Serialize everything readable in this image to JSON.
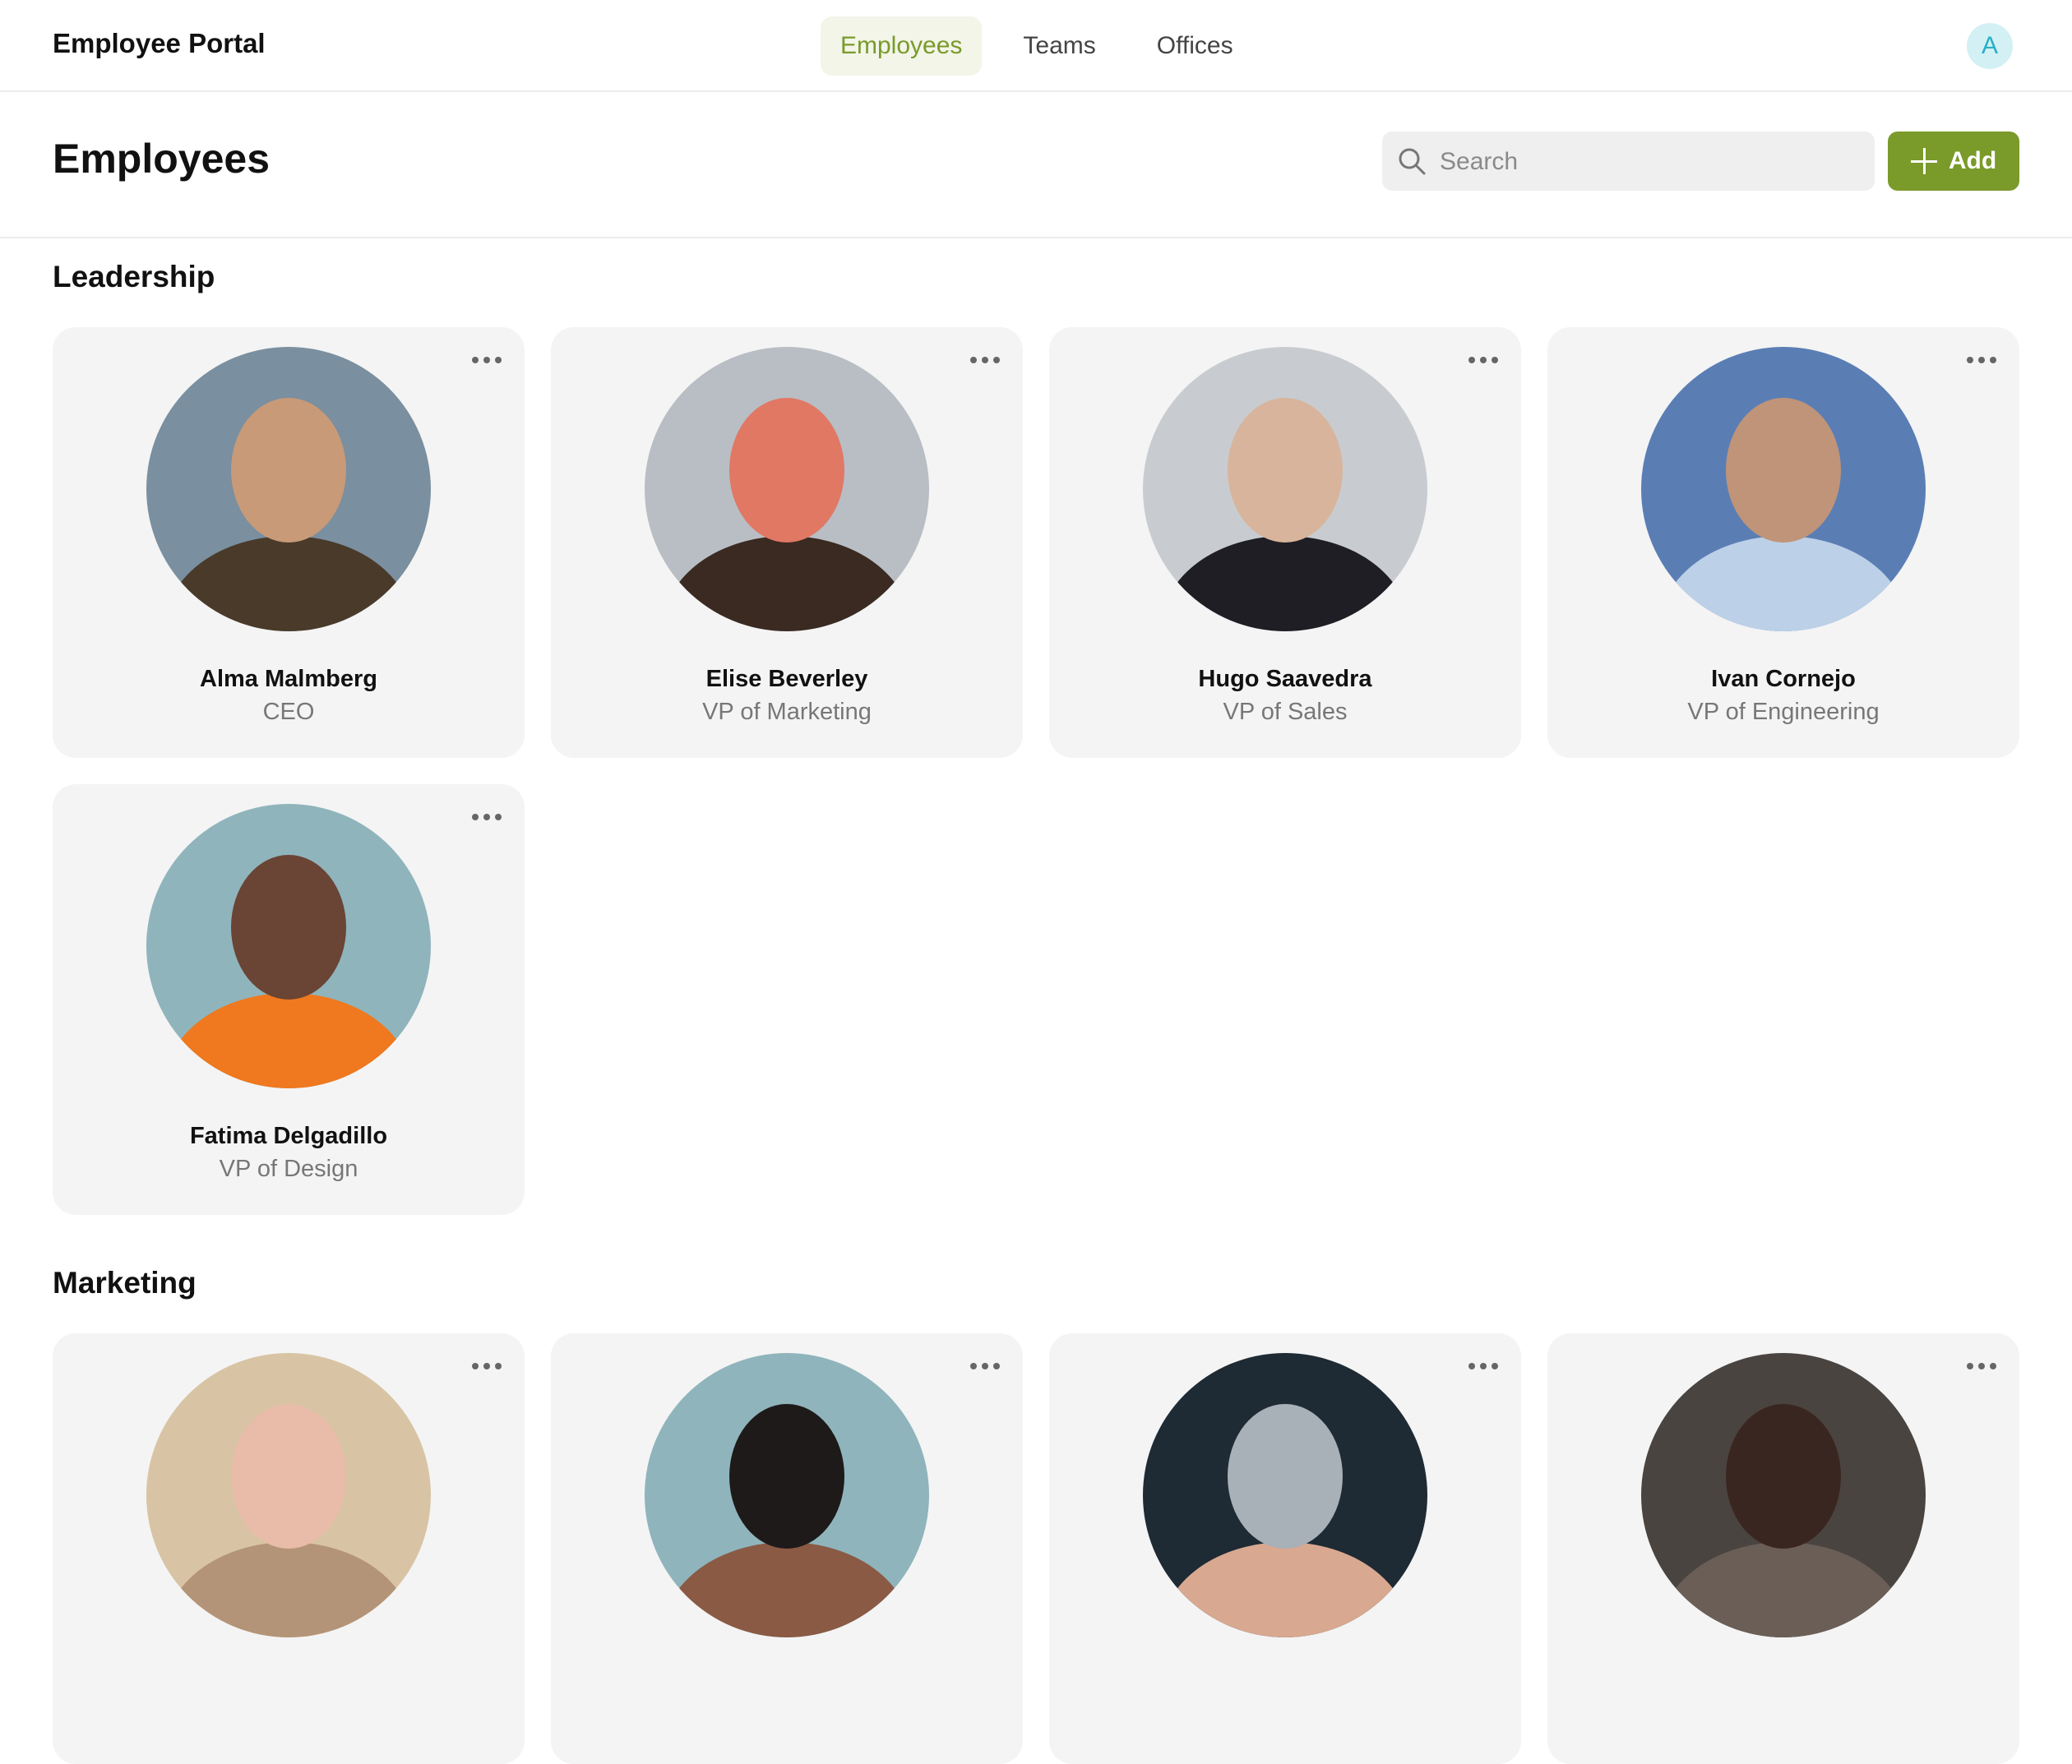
{
  "app": {
    "title": "Employee Portal"
  },
  "nav": {
    "items": [
      {
        "label": "Employees",
        "active": true
      },
      {
        "label": "Teams",
        "active": false
      },
      {
        "label": "Offices",
        "active": false
      }
    ]
  },
  "user": {
    "avatar_initial": "A"
  },
  "page": {
    "title": "Employees",
    "search_placeholder": "Search",
    "search_value": "",
    "add_label": "Add"
  },
  "colors": {
    "accent": "#7a9a2a",
    "accent_bg": "#f2f5e8",
    "avatar_bg": "#d3f0f4",
    "avatar_fg": "#26b0c8",
    "card_bg": "#f4f4f4"
  },
  "icons": {
    "search": "search-icon",
    "add": "plus-icon",
    "more": "more-horizontal-icon"
  },
  "sections": [
    {
      "title": "Leadership",
      "employees": [
        {
          "name": "Alma Malmberg",
          "role": "CEO",
          "photo_colors": [
            "#7a8f9f",
            "#c89a78",
            "#4a3a2a"
          ]
        },
        {
          "name": "Elise Beverley",
          "role": "VP of Marketing",
          "photo_colors": [
            "#b8bec4",
            "#e07864",
            "#3a2a22"
          ]
        },
        {
          "name": "Hugo Saavedra",
          "role": "VP of Sales",
          "photo_colors": [
            "#c8ccd0",
            "#d8b49c",
            "#1e1e24"
          ]
        },
        {
          "name": "Ivan Cornejo",
          "role": "VP of Engineering",
          "photo_colors": [
            "#5a7eb4",
            "#c09478",
            "#bcd0e8"
          ]
        },
        {
          "name": "Fatima Delgadillo",
          "role": "VP of Design",
          "photo_colors": [
            "#8fb4bc",
            "#6a4434",
            "#f0781e"
          ]
        }
      ]
    },
    {
      "title": "Marketing",
      "employees": [
        {
          "name": "",
          "role": "",
          "photo_colors": [
            "#d8c4a4",
            "#e8bca8",
            "#b49478"
          ]
        },
        {
          "name": "",
          "role": "",
          "photo_colors": [
            "#8fb4bc",
            "#1e1a1a",
            "#8a5a44"
          ]
        },
        {
          "name": "",
          "role": "",
          "photo_colors": [
            "#1e2a34",
            "#a8b0b8",
            "#d8a890"
          ]
        },
        {
          "name": "",
          "role": "",
          "photo_colors": [
            "#4a4440",
            "#3a2620",
            "#6a5e56"
          ]
        }
      ]
    }
  ]
}
